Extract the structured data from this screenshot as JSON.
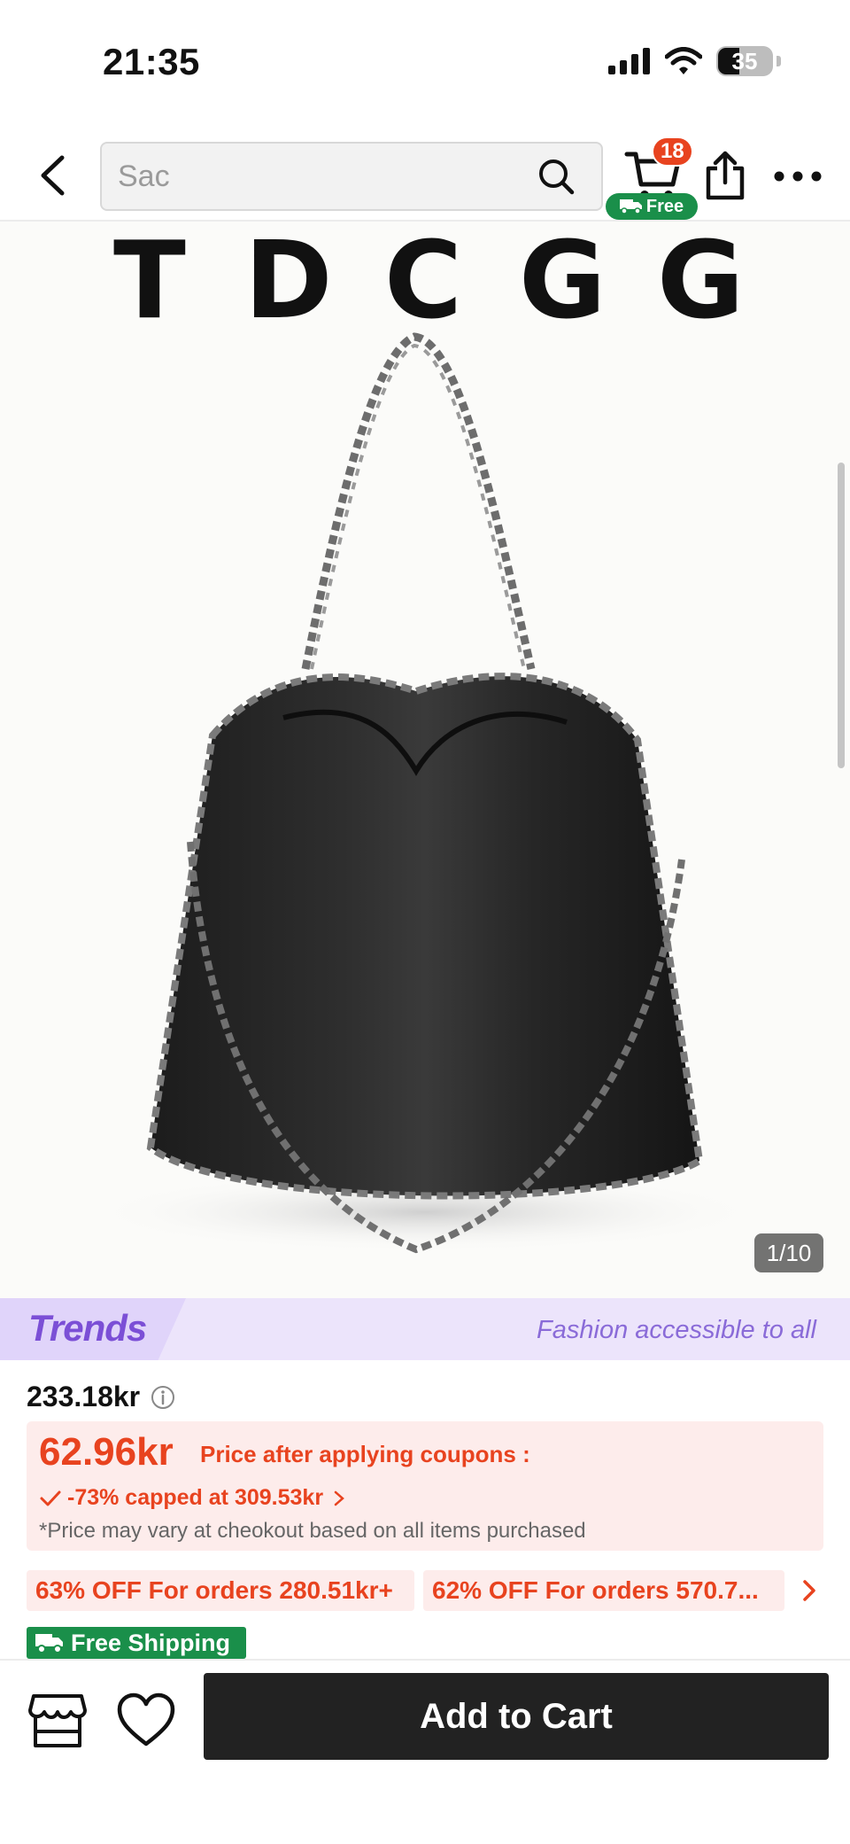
{
  "status_bar": {
    "time": "21:35",
    "battery": "35"
  },
  "header": {
    "search_placeholder": "Sac",
    "cart_count": "18",
    "free_badge": "Free"
  },
  "product_image": {
    "brand_letters": [
      "T",
      "D",
      "C",
      "G",
      "G"
    ],
    "counter": "1/10"
  },
  "trends": {
    "logo": "Trends",
    "tagline": "Fashion accessible to all"
  },
  "price": {
    "original": "233.18kr",
    "coupon_price": "62.96kr",
    "coupon_label": "Price after applying coupons :",
    "discount_text": "-73% capped at 309.53kr",
    "note": "*Price may vary at cheokout based on all items purchased"
  },
  "promos": [
    "63% OFF For orders 280.51kr+",
    "62% OFF For orders 570.7..."
  ],
  "free_shipping": "Free Shipping",
  "bottom_bar": {
    "add_to_cart": "Add to Cart"
  },
  "colors": {
    "accent": "#e8431f",
    "green": "#1a8f4a",
    "trends_purple": "#7b4fd6",
    "dark_button": "#222222"
  }
}
